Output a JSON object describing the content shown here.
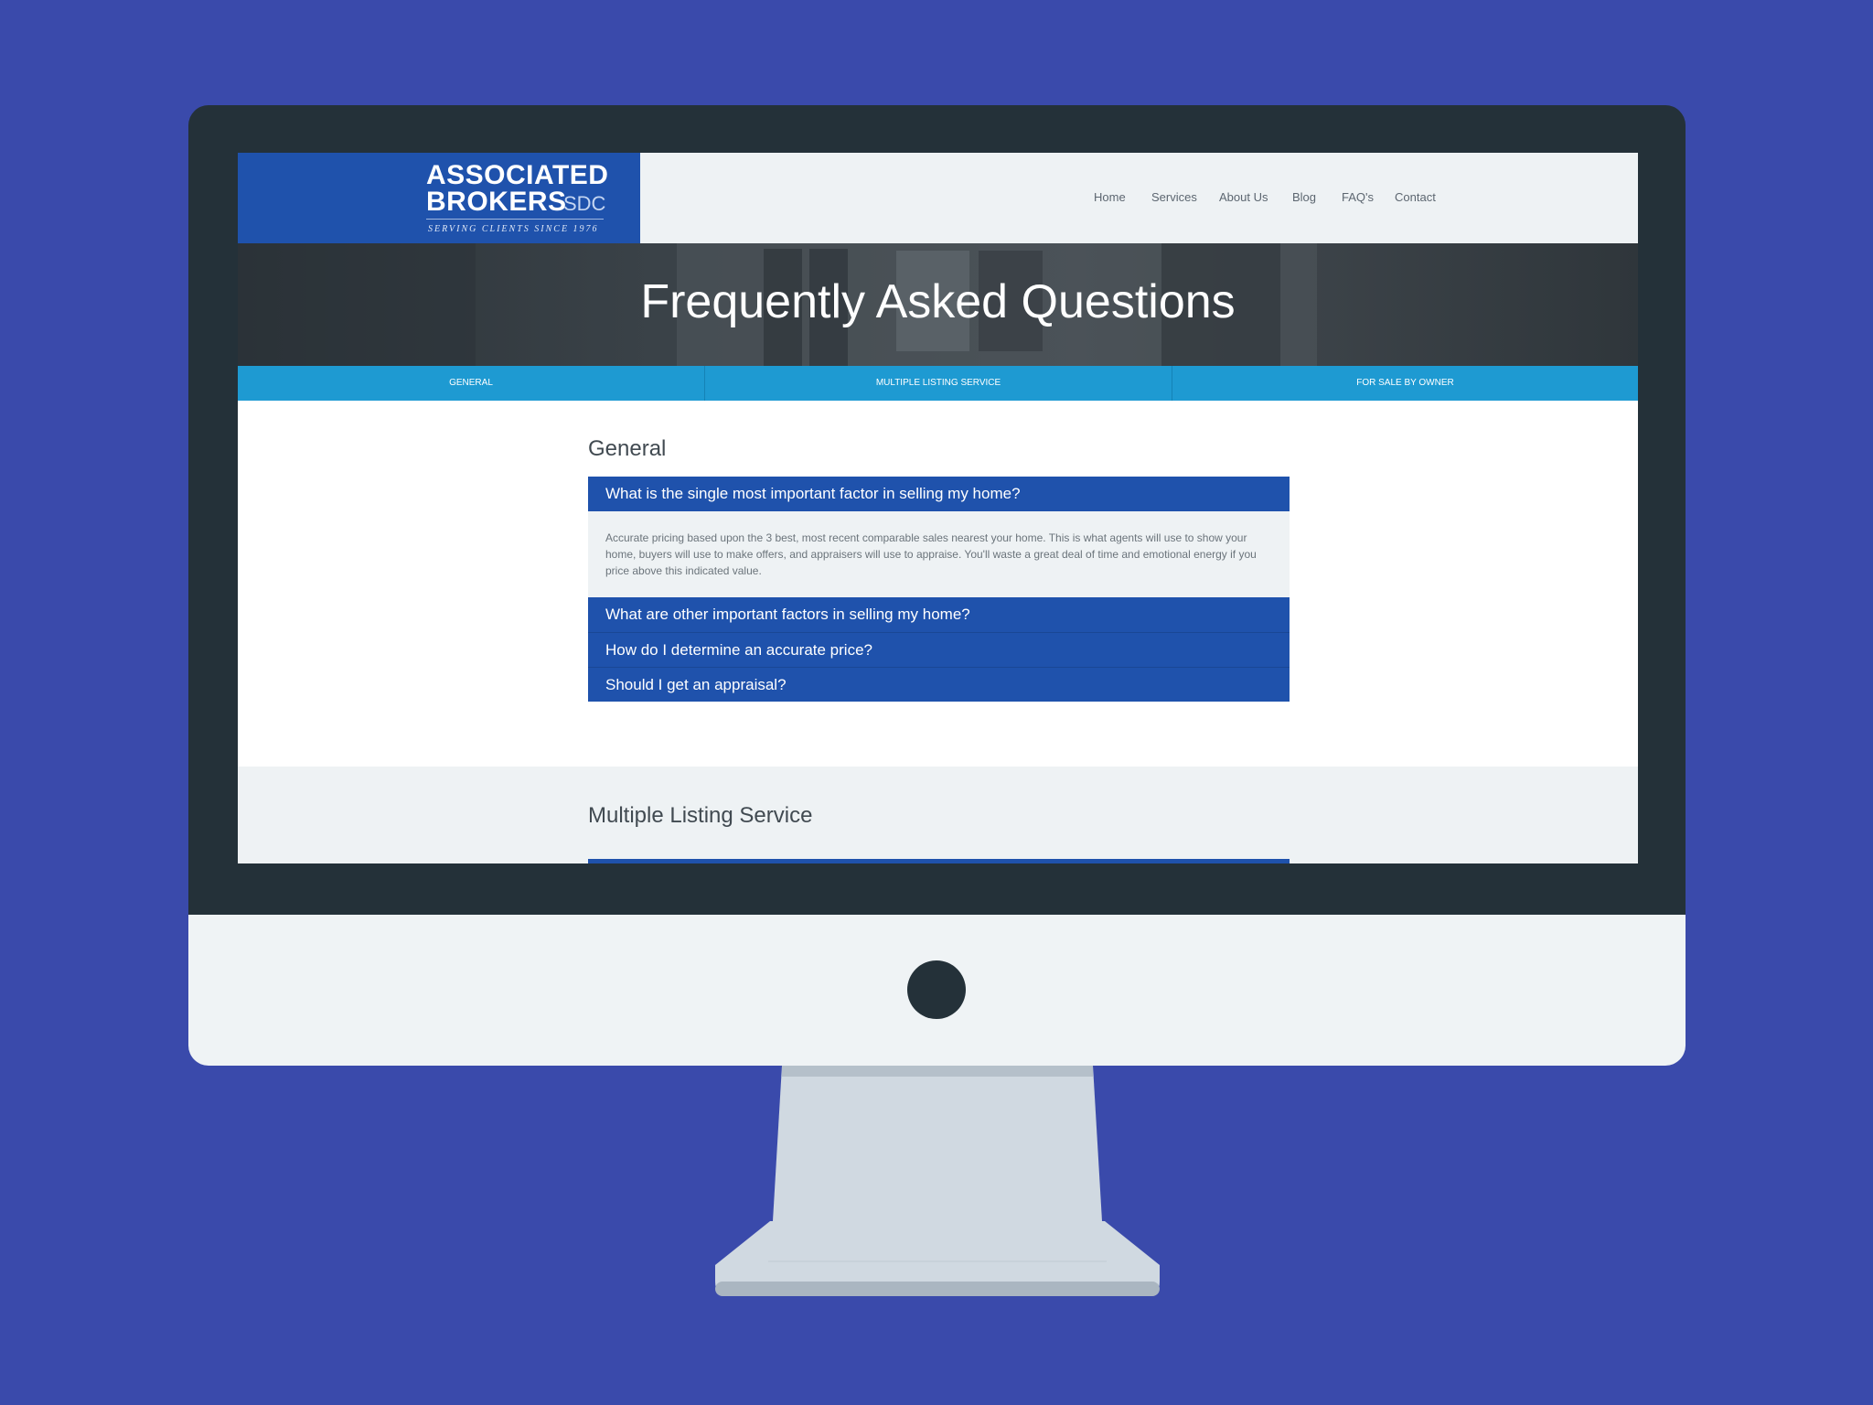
{
  "brand": {
    "name_line1": "ASSOCIATED",
    "name_line2": "BROKERS",
    "suffix": "SDC",
    "tagline": "SERVING CLIENTS SINCE 1976"
  },
  "nav": {
    "items": [
      {
        "label": "Home"
      },
      {
        "label": "Services"
      },
      {
        "label": "About Us"
      },
      {
        "label": "Blog"
      },
      {
        "label": "FAQ's"
      },
      {
        "label": "Contact"
      }
    ]
  },
  "hero": {
    "title": "Frequently Asked Questions"
  },
  "tabs": [
    {
      "label": "GENERAL"
    },
    {
      "label": "MULTIPLE LISTING SERVICE"
    },
    {
      "label": "FOR SALE BY OWNER"
    }
  ],
  "general": {
    "title": "General",
    "faqs": [
      {
        "question": "What is the single most important factor in selling my home?",
        "answer": "Accurate pricing based upon the 3 best, most recent comparable sales nearest your home. This is what agents will use to show your home, buyers will use to make offers, and appraisers will use to appraise. You'll waste a great deal of time and emotional energy if you price above this indicated value."
      },
      {
        "question": "What are other important factors in selling my home?"
      },
      {
        "question": "How do I determine an accurate price?"
      },
      {
        "question": "Should I get an appraisal?"
      }
    ]
  },
  "mls": {
    "title": "Multiple Listing Service"
  },
  "colors": {
    "background": "#3a4aab",
    "brand_blue": "#1f52ac",
    "tab_blue": "#1e9ad2",
    "bezel": "#243139",
    "light_gray": "#eef2f4"
  }
}
